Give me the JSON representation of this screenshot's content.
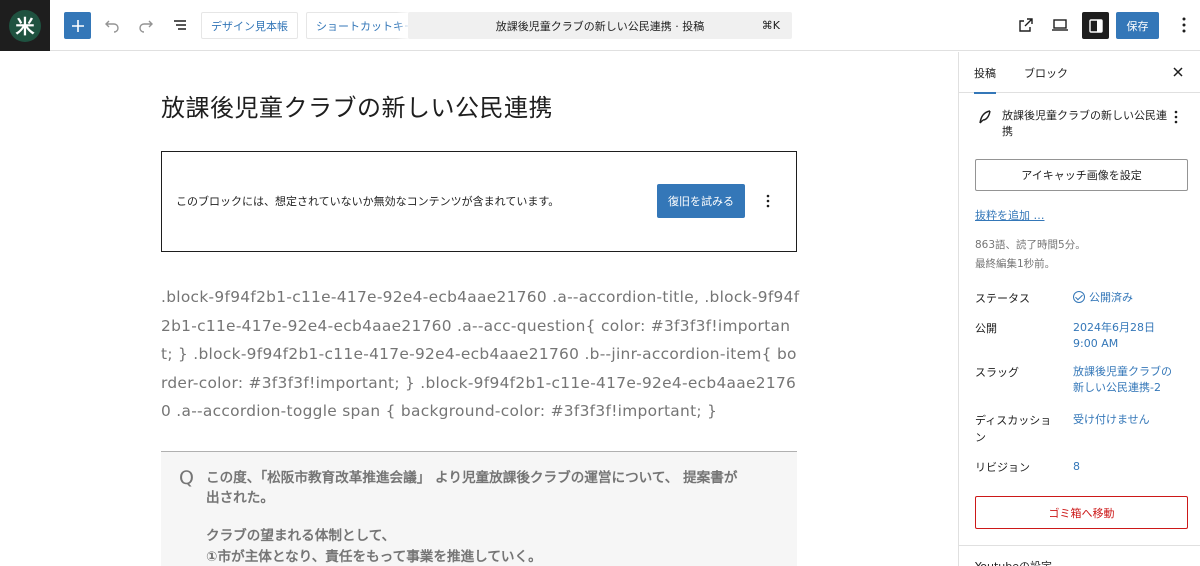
{
  "topbar": {
    "logo_glyph": "米",
    "add_block_icon": "plus-icon",
    "undo_icon": "undo-icon",
    "redo_icon": "redo-icon",
    "list_view_icon": "list-view-icon",
    "design_library_label": "デザイン見本帳",
    "shortcut_key_label": "ショートカットキー",
    "command_center_title": "放課後児童クラブの新しい公民連携 · 投稿",
    "command_center_shortcut": "⌘K",
    "view_post_icon": "external-link-icon",
    "preview_icon": "desktop-preview-icon",
    "settings_icon": "sidebar-toggle-icon",
    "save_label": "保存",
    "options_icon": "kebab-icon"
  },
  "editor": {
    "post_title": "放課後児童クラブの新しい公民連携",
    "invalid_block": {
      "message": "このブロックには、想定されていないか無効なコンテンツが含まれています。",
      "recover_label": "復旧を試みる"
    },
    "css_text": ".block-9f94f2b1-c11e-417e-92e4-ecb4aae21760 .a--accordion-title, .block-9f94f2b1-c11e-417e-92e4-ecb4aae21760 .a--acc-question{ color: #3f3f3f!important; } .block-9f94f2b1-c11e-417e-92e4-ecb4aae21760 .b--jinr-accordion-item{ border-color: #3f3f3f!important; } .block-9f94f2b1-c11e-417e-92e4-ecb4aae21760 .a--accordion-toggle span { background-color: #3f3f3f!important; }",
    "qa": {
      "q_mark": "Q",
      "question": "この度、「松阪市教育改革推進会議」 より児童放課後クラブの運営について、 提案書が出された。",
      "answer_line1": "クラブの望まれる体制として、",
      "answer_line2": "①市が主体となり、責任をもって事業を推進していく。"
    }
  },
  "sidebar": {
    "tab_post": "投稿",
    "tab_block": "ブロック",
    "summary_title": "放課後児童クラブの新しい公民連携",
    "featured_image_label": "アイキャッチ画像を設定",
    "excerpt_link": "抜粋を追加 …",
    "word_count": "863語、読了時間5分。",
    "last_edited": "最終編集1秒前。",
    "rows": {
      "status_label": "ステータス",
      "status_value": "公開済み",
      "publish_label": "公開",
      "publish_value_date": "2024年6月28日",
      "publish_value_time": "9:00 AM",
      "slug_label": "スラッグ",
      "slug_value_1": "放課後児童クラブの",
      "slug_value_2": "新しい公民連携-2",
      "discussion_label_1": "ディスカッショ",
      "discussion_label_2": "ン",
      "discussion_value": "受け付けません",
      "revisions_label": "リビジョン",
      "revisions_value": "8"
    },
    "trash_label": "ゴミ箱へ移動",
    "youtube_heading": "Youtubeの設定"
  }
}
